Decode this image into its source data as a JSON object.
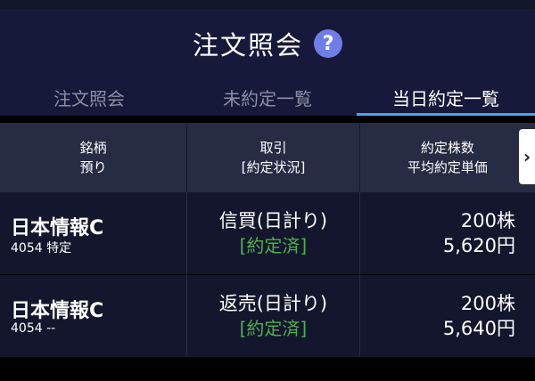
{
  "header": {
    "title": "注文照会",
    "help_symbol": "?"
  },
  "tabs": [
    {
      "label": "注文照会",
      "active": false
    },
    {
      "label": "未約定一覧",
      "active": false
    },
    {
      "label": "当日約定一覧",
      "active": true
    }
  ],
  "table": {
    "columns": [
      {
        "line1": "銘柄",
        "line2": "預り"
      },
      {
        "line1": "取引",
        "line2": "[約定状況]"
      },
      {
        "line1": "約定株数",
        "line2": "平均約定単価"
      }
    ],
    "scroll_symbol": "›",
    "rows": [
      {
        "name": "日本情報C",
        "code_account": "4054 特定",
        "trade_type": "信買(日計り)",
        "status": "[約定済]",
        "quantity": "200株",
        "avg_price": "5,620円"
      },
      {
        "name": "日本情報C",
        "code_account": "4054 --",
        "trade_type": "返売(日計り)",
        "status": "[約定済]",
        "quantity": "200株",
        "avg_price": "5,640円"
      }
    ]
  },
  "colors": {
    "header_bg": "#16193a",
    "tab_indicator": "#4aa4e8",
    "status_green": "#4fb04a",
    "help_icon": "#6f7de6"
  }
}
